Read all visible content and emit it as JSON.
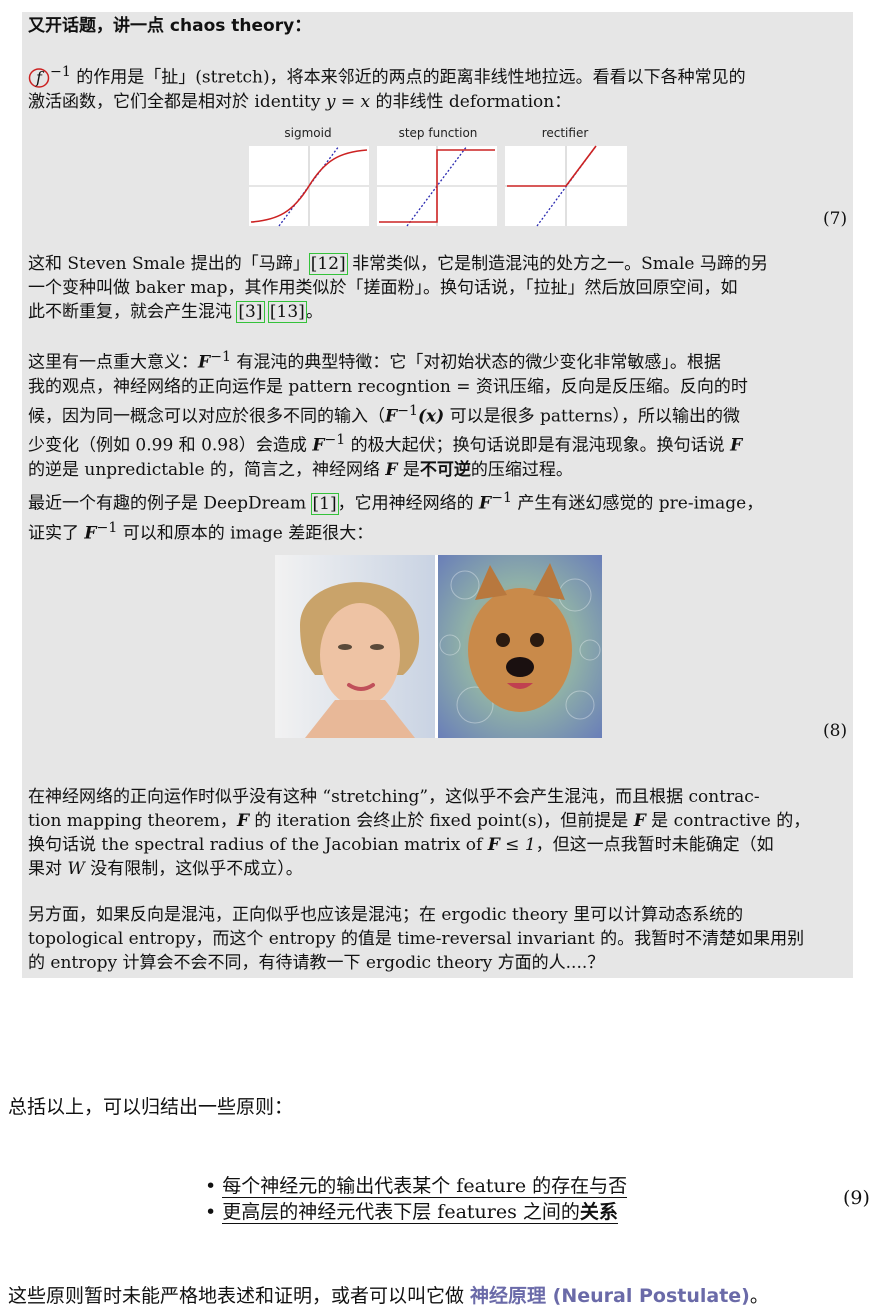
{
  "box": {
    "heading": "又开话题，讲一点 chaos theory：",
    "p1": {
      "sup": "−1",
      "text_a": " 的作用是「扯」(stretch)，将本来邻近的两点的距离非线性地拉远。看看以下各种常见的",
      "text_b": "激活函数，它们全都是相对於 identity ",
      "math_identity": "y = x",
      "text_c": " 的非线性 deformation："
    },
    "figure7": {
      "labels": [
        "sigmoid",
        "step function",
        "rectifier"
      ],
      "eq_number": "(7)"
    },
    "p2": {
      "a": "这和 Steven Smale 提出的「马蹄」",
      "cite1": "[12]",
      "b": " 非常类似，它是制造混沌的处方之一。Smale 马蹄的另",
      "c": "一个变种叫做 baker map，其作用类似於「搓面粉」。换句话说，「拉扯」然后放回原空间，如",
      "d": "此不断重复，就会产生混沌 ",
      "cite2": "[3]",
      "cite3": "[13]",
      "e": "。"
    },
    "p3": {
      "l1a": "这里有一点重大意义：",
      "F": "F",
      "sup": "−1",
      "l1b": " 有混沌的典型特徵：它「对初始状态的微少变化非常敏感」。根据",
      "l2": "我的观点，神经网络的正向运作是 pattern recogntion = 资讯压缩，反向是反压缩。反向的时",
      "l3a": "候，因为同一概念可以对应於很多不同的输入（",
      "l3x": "(x)",
      "l3b": " 可以是很多 patterns），所以输出的微",
      "l4a": "少变化（例如 0.99 和 0.98）会造成 ",
      "l4b": " 的极大起伏；换句话说即是有混沌现象。换句话说 ",
      "l5a": "的逆是 unpredictable 的，简言之，神经网络 ",
      "l5b": " 是",
      "l5bold": "不可逆",
      "l5c": "的压缩过程。"
    },
    "p4": {
      "a": "最近一个有趣的例子是 DeepDream ",
      "cite": "[1]",
      "b": "，它用神经网络的 ",
      "c": " 产生有迷幻感觉的 pre-image，",
      "d": "证实了 ",
      "e": " 可以和原本的 image 差距很大："
    },
    "figure8": {
      "eq_number": "(8)"
    },
    "p5": {
      "l1": "在神经网络的正向运作时似乎没有这种 “stretching”，这似乎不会产生混沌，而且根据 contrac-",
      "l2a": "tion mapping theorem，",
      "l2b": " 的 iteration 会终止於 fixed point(s)，但前提是 ",
      "l2c": " 是 contractive 的，",
      "l3a": "换句话说 the spectral radius of the Jacobian matrix of ",
      "l3m": " ≤ 1",
      "l3b": "，但这一点我暂时未能确定（如",
      "l4a": "果对 ",
      "W": "W",
      "l4b": " 没有限制，这似乎不成立）。"
    },
    "p6": {
      "l1": "另方面，如果反向是混沌，正向似乎也应该是混沌；在 ergodic theory 里可以计算动态系统的",
      "l2": "topological entropy，而这个 entropy 的值是 time-reversal invariant 的。我暂时不清楚如果用别",
      "l3": "的 entropy 计算会不会不同，有待请教一下 ergodic theory 方面的人....？"
    }
  },
  "summary": "总括以上，可以归结出一些原则：",
  "principles": {
    "items": [
      {
        "text": "每个神经元的输出代表某个 feature 的存在与否",
        "bold": ""
      },
      {
        "text": "更高层的神经元代表下层 features 之间的",
        "bold": "关系"
      }
    ],
    "eq_number": "(9)"
  },
  "closing": {
    "text": "这些原则暂时未能严格地表述和证明，或者可以叫它做 ",
    "link": "神经原理 (Neural Postulate)",
    "end": "。"
  },
  "colors": {
    "box_bg": "#e6e6e6",
    "curve_red": "#cc2222",
    "diag_blue": "#2a2ab0",
    "cite_green": "#34c23a",
    "link": "#6a6aa8"
  }
}
